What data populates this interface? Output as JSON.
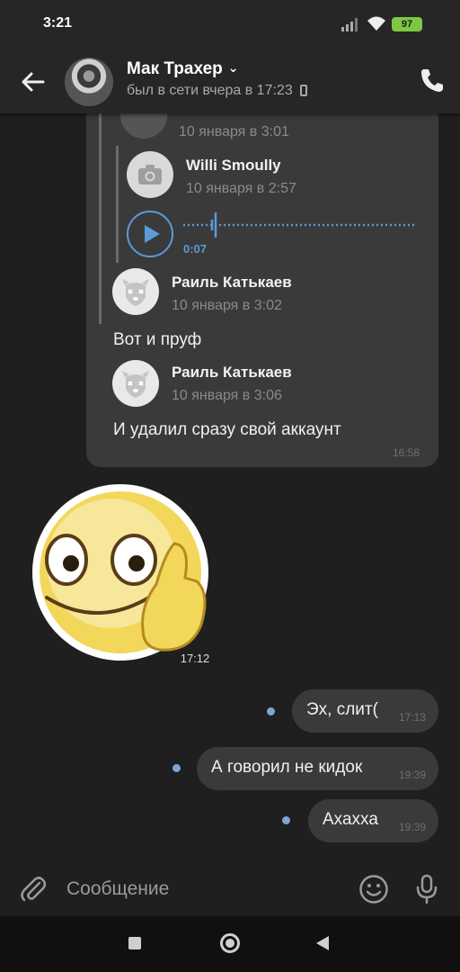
{
  "status_bar": {
    "time": "3:21",
    "battery": "97"
  },
  "header": {
    "contact_name": "Мак Трахер",
    "contact_status": "был в сети вчера в 17:23"
  },
  "forwarded": {
    "top_date": "10 января в 3:01",
    "voice": {
      "sender": "Willi Smoully",
      "date": "10 января в 2:57",
      "duration": "0:07"
    },
    "msg1": {
      "sender": "Раиль Катькаев",
      "date": "10 января в 3:02",
      "text": "Вот и пруф"
    },
    "msg2": {
      "sender": "Раиль Катькаев",
      "date": "10 января в 3:06",
      "text": "И удалил сразу свой аккаунт"
    },
    "time": "16:58"
  },
  "sticker": {
    "time": "17:12"
  },
  "outgoing": [
    {
      "text": "Эх, слит(",
      "time": "17:13"
    },
    {
      "text": "А говорил не кидок",
      "time": "19:39"
    },
    {
      "text": "Ахахха",
      "time": "19:39"
    }
  ],
  "composer": {
    "placeholder": "Сообщение"
  },
  "icons": {
    "back": "arrow-left-icon",
    "call": "phone-icon",
    "attach": "paperclip-icon",
    "emoji": "smile-icon",
    "mic": "microphone-icon",
    "camera": "camera-icon",
    "play": "play-icon"
  },
  "colors": {
    "accent": "#5b9bd8",
    "bubble": "#3a3a3a",
    "background": "#1f1f1f",
    "battery": "#7ec742"
  }
}
